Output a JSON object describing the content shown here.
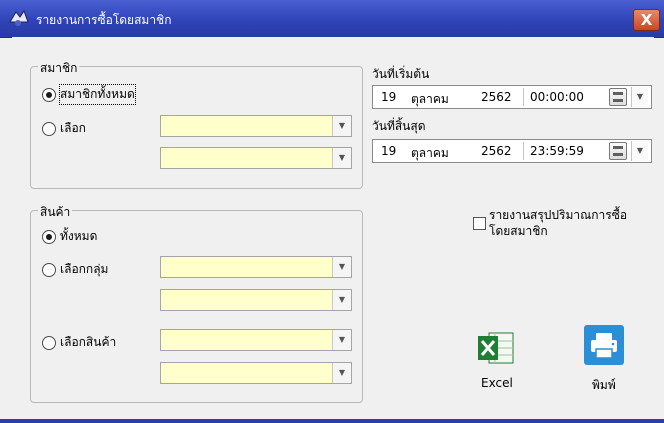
{
  "window": {
    "title": "รายงานการซื้อโดยสมาชิก",
    "close_label": "X"
  },
  "members": {
    "legend": "สมาชิก",
    "option_all": "สมาชิกทั้งหมด",
    "option_select": "เลือก"
  },
  "products": {
    "legend": "สินค้า",
    "option_all": "ทั้งหมด",
    "option_group": "เลือกกลุ่ม",
    "option_item": "เลือกสินค้า"
  },
  "dates": {
    "start_label": "วันที่เริ่มต้น",
    "start": {
      "day": "19",
      "month": "ตุลาคม",
      "year": "2562",
      "time": "00:00:00"
    },
    "end_label": "วันที่สิ้นสุด",
    "end": {
      "day": "19",
      "month": "ตุลาคม",
      "year": "2562",
      "time": "23:59:59"
    }
  },
  "summary_checkbox": {
    "line1": "รายงานสรุปปริมาณการซื้อ",
    "line2": "โดยสมาชิก",
    "checked": false
  },
  "actions": {
    "excel_label": "Excel",
    "print_label": "พิมพ์"
  },
  "colors": {
    "titlebar": "#2f44b8",
    "combo_bg": "#ffffcc",
    "print_icon": "#2a8fd6",
    "excel_green": "#1e7e34"
  }
}
